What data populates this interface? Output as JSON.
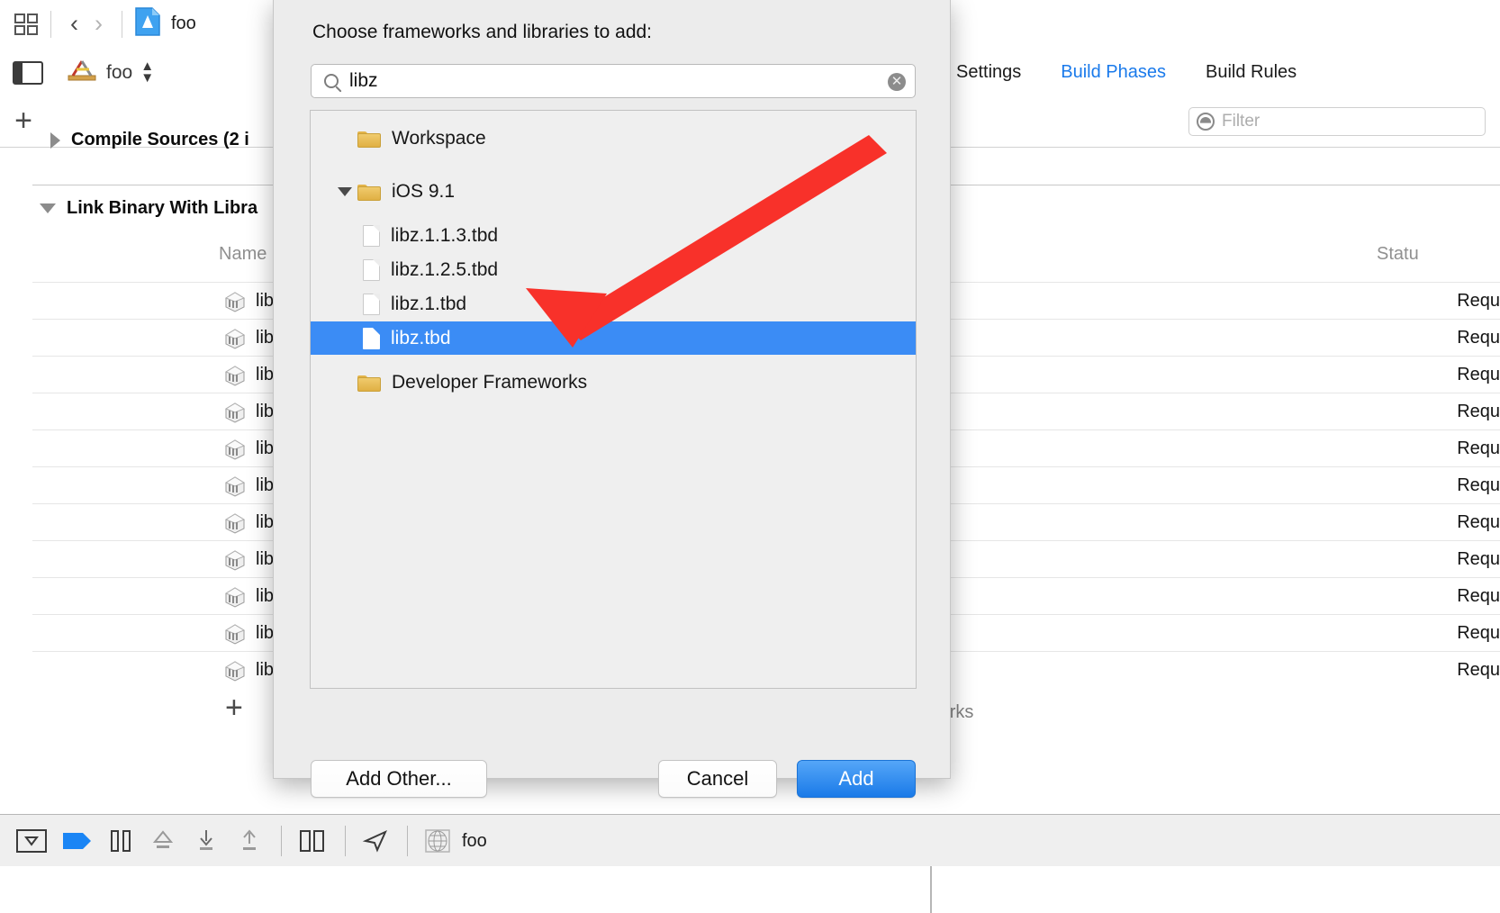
{
  "window": {
    "toolbar": {
      "grid_icon": "grid-icon",
      "back_icon": "chevron-left-icon",
      "forward_icon": "chevron-right-icon",
      "doc_icon": "xcode-project-icon",
      "doc_title": "foo"
    },
    "jumpbar": {
      "panel_toggle_icon": "navigator-toggle-icon",
      "scheme_icon": "xcode-target-icon",
      "scheme_label": "foo",
      "stepper_icon": "stepper-up-down-icon"
    },
    "add_button_label": "+",
    "tabs": [
      {
        "label": "Settings",
        "active": false
      },
      {
        "label": "Build Phases",
        "active": true
      },
      {
        "label": "Build Rules",
        "active": false
      }
    ],
    "filter": {
      "placeholder": "Filter",
      "icon": "filter-icon",
      "value": ""
    }
  },
  "build_phases": {
    "compile_sources_header": "Compile Sources (2 i",
    "link_binary_header": "Link Binary With Libra",
    "table": {
      "columns": [
        "Name",
        "Statu"
      ],
      "rows": [
        {
          "name": "lib",
          "status": "Requ",
          "icon": "library-icon"
        },
        {
          "name": "lib",
          "status": "Requ",
          "icon": "library-icon"
        },
        {
          "name": "lib",
          "status": "Requ",
          "icon": "library-icon"
        },
        {
          "name": "lib",
          "status": "Requ",
          "icon": "library-icon"
        },
        {
          "name": "lib",
          "status": "Requ",
          "icon": "library-icon"
        },
        {
          "name": "lib",
          "status": "Requ",
          "icon": "library-icon"
        },
        {
          "name": "lib",
          "status": "Requ",
          "icon": "library-icon"
        },
        {
          "name": "lib",
          "status": "Requ",
          "icon": "library-icon"
        },
        {
          "name": "lib",
          "status": "Requ",
          "icon": "library-icon"
        },
        {
          "name": "lib",
          "status": "Requ",
          "icon": "library-icon"
        },
        {
          "name": "lib",
          "status": "Requ",
          "icon": "library-icon"
        }
      ]
    },
    "footer_add_label": "+",
    "footer_note": "eworks"
  },
  "bottom_toolbar": {
    "icons": [
      "hide-debug-area-icon",
      "breakpoints-icon",
      "pause-icon",
      "step-over-icon",
      "step-into-icon",
      "step-out-icon",
      "view-hierarchy-icon",
      "location-icon",
      "memory-graph-icon"
    ],
    "process_label": "foo"
  },
  "dialog": {
    "title": "Choose frameworks and libraries to add:",
    "search": {
      "icon": "search-icon",
      "value": "libz",
      "placeholder": "",
      "clear_icon": "clear-icon"
    },
    "tree": [
      {
        "label": "Workspace",
        "type": "folder",
        "depth": 0,
        "expanded": null,
        "selected": false
      },
      {
        "label": "iOS 9.1",
        "type": "folder",
        "depth": 0,
        "expanded": true,
        "selected": false
      },
      {
        "label": "libz.1.1.3.tbd",
        "type": "file",
        "depth": 1,
        "expanded": null,
        "selected": false
      },
      {
        "label": "libz.1.2.5.tbd",
        "type": "file",
        "depth": 1,
        "expanded": null,
        "selected": false
      },
      {
        "label": "libz.1.tbd",
        "type": "file",
        "depth": 1,
        "expanded": null,
        "selected": false
      },
      {
        "label": "libz.tbd",
        "type": "file",
        "depth": 1,
        "expanded": null,
        "selected": true
      },
      {
        "label": "Developer Frameworks",
        "type": "folder",
        "depth": 0,
        "expanded": null,
        "selected": false
      }
    ],
    "buttons": {
      "add_other": "Add Other...",
      "cancel": "Cancel",
      "add": "Add"
    }
  },
  "annotation": {
    "arrow_color": "#f8312a",
    "arrow_icon": "red-arrow-pointer"
  },
  "colors": {
    "accent_blue": "#1a7aeb",
    "selection_blue": "#3b8cf5",
    "sheet_bg": "#ececec",
    "window_bg": "#ffffff",
    "toolbar_bg": "#efefef",
    "arrow_red": "#f8312a"
  }
}
